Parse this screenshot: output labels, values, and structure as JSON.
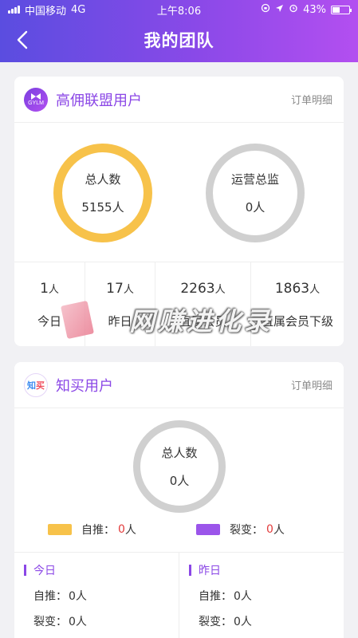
{
  "status_bar": {
    "carrier": "中国移动",
    "network": "4G",
    "time": "上午8:06",
    "battery": "43%",
    "battery_level": 0.43
  },
  "nav": {
    "title": "我的团队"
  },
  "card1": {
    "logo_text": "GYLM",
    "title": "高佣联盟用户",
    "link": "订单明细",
    "circle_left": {
      "label": "总人数",
      "value": "5155人"
    },
    "circle_right": {
      "label": "运营总监",
      "value": "0人"
    },
    "stats": [
      {
        "num": "1",
        "unit": "人",
        "label": "今日"
      },
      {
        "num": "17",
        "unit": "人",
        "label": "昨日"
      },
      {
        "num": "2263",
        "unit": "人",
        "label": "直属会员"
      },
      {
        "num": "1863",
        "unit": "人",
        "label": "直属会员下级"
      }
    ]
  },
  "watermark": "网赚进化录",
  "card2": {
    "logo_a": "知",
    "logo_b": "买",
    "title": "知买用户",
    "link": "订单明细",
    "circle": {
      "label": "总人数",
      "value": "0人"
    },
    "legend": [
      {
        "label": "自推：",
        "num": "0",
        "unit": "人",
        "color": "#f7c24a"
      },
      {
        "label": "裂变：",
        "num": "0",
        "unit": "人",
        "color": "#9b55ea"
      }
    ],
    "today": {
      "title": "今日",
      "self_label": "自推：",
      "self_num": "0",
      "self_unit": "人",
      "fission_label": "裂变：",
      "fission_num": "0",
      "fission_unit": "人"
    },
    "yesterday": {
      "title": "昨日",
      "self_label": "自推：",
      "self_num": "0",
      "self_unit": "人",
      "fission_label": "裂变：",
      "fission_num": "0",
      "fission_unit": "人"
    }
  },
  "colors": {
    "accent": "#8b47e6",
    "ring_yellow": "#f7c24a",
    "ring_gray": "#d0d0d0"
  }
}
